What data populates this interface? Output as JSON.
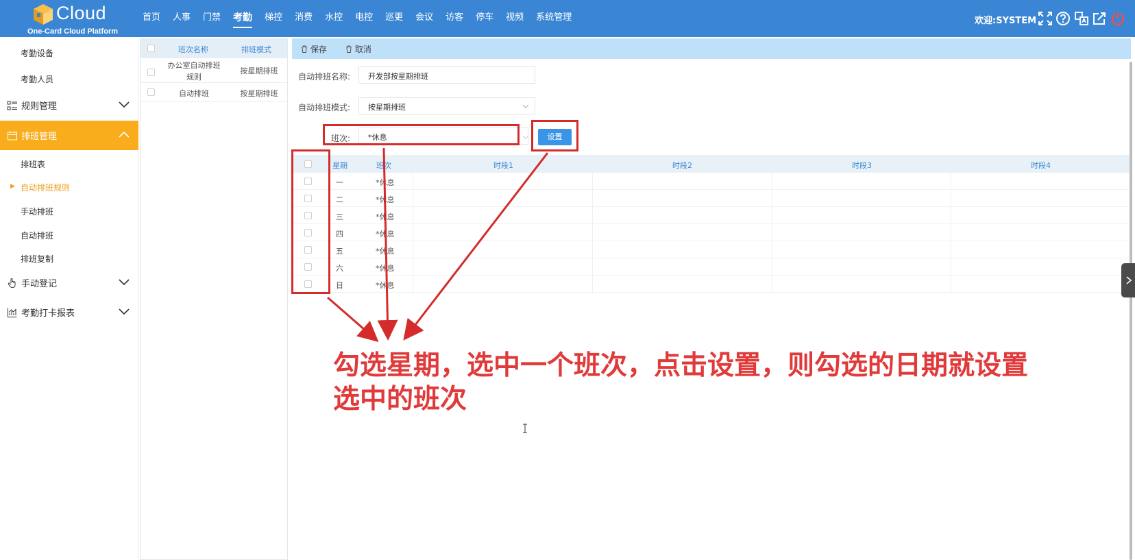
{
  "brand": {
    "name": "Cloud",
    "subtitle": "One-Card Cloud Platform"
  },
  "nav": [
    "首页",
    "人事",
    "门禁",
    "考勤",
    "梯控",
    "消费",
    "水控",
    "电控",
    "巡更",
    "会议",
    "访客",
    "停车",
    "视频",
    "系统管理"
  ],
  "nav_active_index": 3,
  "header": {
    "welcome": "欢迎:SYSTEM",
    "tools": [
      "fullscreen-icon",
      "help-icon",
      "translate-icon",
      "external-link-icon",
      "power-icon"
    ]
  },
  "sidebar": {
    "top_items": [
      "考勤设备",
      "考勤人员"
    ],
    "groups": {
      "rules": "规则管理",
      "schedule": "排班管理",
      "manual_reg": "手动登记",
      "report": "考勤打卡报表"
    },
    "schedule_items": [
      "排班表",
      "自动排班规则",
      "手动排班",
      "自动排班",
      "排班复制"
    ],
    "active_item": "自动排班规则"
  },
  "rule_list": {
    "headers": [
      "班次名称",
      "排班模式"
    ],
    "rows": [
      {
        "name_line1": "办公室自动排班",
        "name_line2": "规则",
        "mode": "按星期排班"
      },
      {
        "name_line1": "自动排班",
        "name_line2": "",
        "mode": "按星期排班"
      }
    ]
  },
  "toolbar": {
    "save": "保存",
    "cancel": "取消"
  },
  "form": {
    "name_label": "自动排班名称:",
    "name_value": "开发部按星期排班",
    "mode_label": "自动排班模式:",
    "mode_value": "按星期排班",
    "shift_label": "班次:",
    "shift_value": "*休息",
    "set_button": "设置"
  },
  "grid": {
    "headers": [
      "星期",
      "班次",
      "时段1",
      "时段2",
      "时段3",
      "时段4"
    ],
    "rows": [
      {
        "day": "一",
        "shift": "*休息"
      },
      {
        "day": "二",
        "shift": "*休息"
      },
      {
        "day": "三",
        "shift": "*休息"
      },
      {
        "day": "四",
        "shift": "*休息"
      },
      {
        "day": "五",
        "shift": "*休息"
      },
      {
        "day": "六",
        "shift": "*休息"
      },
      {
        "day": "日",
        "shift": "*休息"
      }
    ]
  },
  "annotation": {
    "line1": "勾选星期，选中一个班次，点击设置，则勾选的日期就设置",
    "line2": "选中的班次"
  },
  "colors": {
    "topbar": "#3a86d4",
    "active_menu": "#f9ac1c",
    "annotation": "#d42b2b",
    "toolbar": "#bfe0f9",
    "set_button": "#3a95e8"
  }
}
